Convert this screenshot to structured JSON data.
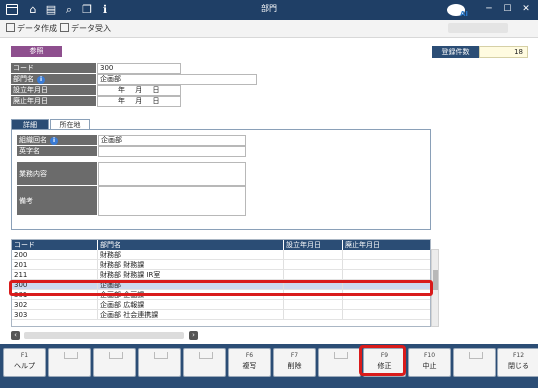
{
  "window": {
    "title": "部門"
  },
  "toolbar": {
    "create_data": "データ作成",
    "import_data": "データ受入"
  },
  "mode_badge": "参照",
  "record_count": {
    "label": "登録件数",
    "value": "18"
  },
  "form": {
    "code_label": "コード",
    "code_value": "300",
    "dept_name_label": "部門名",
    "dept_name_value": "企画部",
    "established_label": "設立年月日",
    "abolished_label": "廃止年月日",
    "date_year": "年",
    "date_month": "月",
    "date_day": "日"
  },
  "tabs": {
    "detail": "詳細",
    "location": "所在地"
  },
  "detail": {
    "org_name_label": "組織回名",
    "org_name_value": "企画部",
    "english_name_label": "英字名",
    "english_name_value": "",
    "business_label": "業務内容",
    "business_value": "",
    "remarks_label": "備考",
    "remarks_value": ""
  },
  "list": {
    "columns": [
      "コード",
      "部門名",
      "設立年月日",
      "廃止年月日"
    ],
    "rows": [
      {
        "code": "200",
        "name": "財務部",
        "est": "",
        "abol": ""
      },
      {
        "code": "201",
        "name": "財務部 財務課",
        "est": "",
        "abol": ""
      },
      {
        "code": "211",
        "name": "財務部 財務課 IR室",
        "est": "",
        "abol": ""
      },
      {
        "code": "300",
        "name": "企画部",
        "est": "",
        "abol": ""
      },
      {
        "code": "301",
        "name": "企画部 企画課",
        "est": "",
        "abol": ""
      },
      {
        "code": "302",
        "name": "企画部 広報課",
        "est": "",
        "abol": ""
      },
      {
        "code": "303",
        "name": "企画部 社会連携課",
        "est": "",
        "abol": ""
      }
    ],
    "selected_index": 3
  },
  "fkeys": [
    {
      "key": "F1",
      "label": "ヘルプ"
    },
    {
      "key": "",
      "label": ""
    },
    {
      "key": "",
      "label": ""
    },
    {
      "key": "",
      "label": ""
    },
    {
      "key": "",
      "label": ""
    },
    {
      "key": "F6",
      "label": "複写"
    },
    {
      "key": "F7",
      "label": "削除"
    },
    {
      "key": "",
      "label": ""
    },
    {
      "key": "F9",
      "label": "修正"
    },
    {
      "key": "F10",
      "label": "中止"
    },
    {
      "key": "",
      "label": ""
    },
    {
      "key": "F12",
      "label": "閉じる"
    }
  ],
  "colors": {
    "navy": "#2b4d75",
    "title_bar": "#1f3f66",
    "badge": "#8e4f8e",
    "highlight": "#d91b1b",
    "selected_row": "#cdd9ee"
  }
}
